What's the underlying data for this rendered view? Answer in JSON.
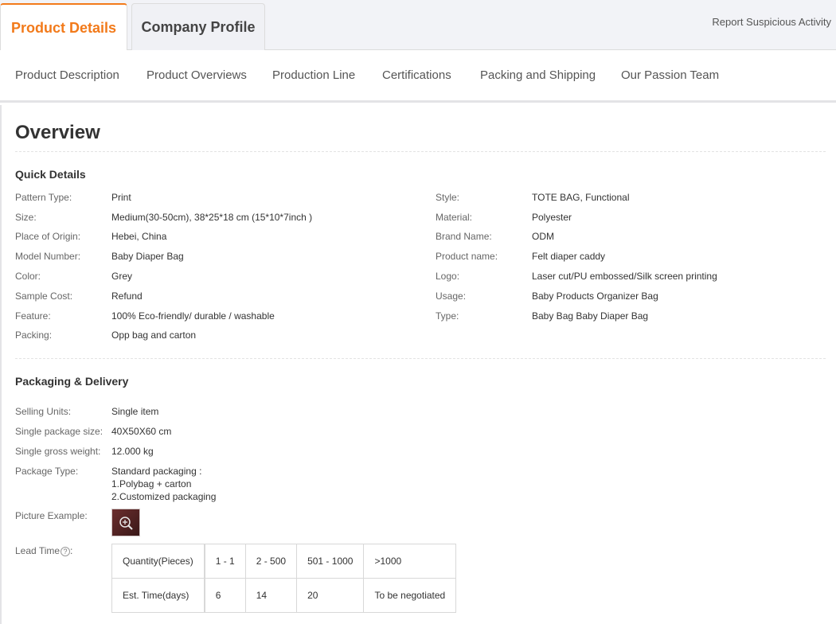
{
  "tabs": {
    "active": "Product Details",
    "inactive": "Company Profile",
    "report": "Report Suspicious Activity"
  },
  "subnav": [
    "Product Description",
    "Product Overviews",
    "Production Line",
    "Certifications",
    "Packing and Shipping",
    "Our Passion Team"
  ],
  "overview": {
    "title": "Overview",
    "quick_title": "Quick Details",
    "left": [
      {
        "label": "Pattern Type:",
        "value": "Print"
      },
      {
        "label": "Size:",
        "value": "Medium(30-50cm), 38*25*18 cm (15*10*7inch )"
      },
      {
        "label": "Place of Origin:",
        "value": "Hebei, China"
      },
      {
        "label": "Model Number:",
        "value": "Baby Diaper Bag"
      },
      {
        "label": "Color:",
        "value": "Grey"
      },
      {
        "label": "Sample Cost:",
        "value": "Refund"
      },
      {
        "label": "Feature:",
        "value": "100% Eco-friendly/ durable / washable"
      },
      {
        "label": "Packing:",
        "value": "Opp bag and carton"
      }
    ],
    "right": [
      {
        "label": "Style:",
        "value": "TOTE BAG, Functional"
      },
      {
        "label": "Material:",
        "value": "Polyester"
      },
      {
        "label": "Brand Name:",
        "value": "ODM"
      },
      {
        "label": "Product name:",
        "value": "Felt diaper caddy"
      },
      {
        "label": "Logo:",
        "value": "Laser cut/PU embossed/Silk screen printing"
      },
      {
        "label": "Usage:",
        "value": "Baby Products Organizer Bag"
      },
      {
        "label": "Type:",
        "value": "Baby Bag Baby Diaper Bag"
      }
    ]
  },
  "packaging": {
    "title": "Packaging & Delivery",
    "selling_units_label": "Selling Units:",
    "selling_units": "Single item",
    "package_size_label": "Single package size:",
    "package_size": "40X50X60 cm",
    "gross_weight_label": "Single gross weight:",
    "gross_weight": "12.000 kg",
    "package_type_label": "Package Type:",
    "package_type_lines": [
      "Standard packaging :",
      "1.Polybag + carton",
      "2.Customized packaging"
    ],
    "picture_label": "Picture Example:",
    "lead_time_label": "Lead Time",
    "help_glyph": "?",
    "lead_table": {
      "row1": [
        "Quantity(Pieces)",
        "1 - 1",
        "2 - 500",
        "501 - 1000",
        ">1000"
      ],
      "row2": [
        "Est. Time(days)",
        "6",
        "14",
        "20",
        "To be negotiated"
      ]
    }
  },
  "icons": {
    "thumb_zoom": "zoom-in-icon",
    "lead_help": "question-circle-icon"
  }
}
